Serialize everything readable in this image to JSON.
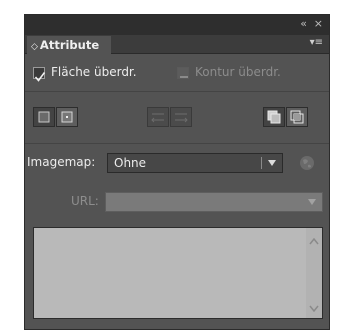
{
  "window": {
    "collapse_glyph": "«",
    "close_glyph": "×"
  },
  "tab": {
    "chevron": "◇",
    "label": "Attribute",
    "menu_glyph": "▾≡"
  },
  "overprint": {
    "fill_label": "Fläche überdr.",
    "fill_checked": true,
    "stroke_label": "Kontur überdr.",
    "stroke_checked": false
  },
  "icons": {
    "group1": [
      "hide-center-icon",
      "show-center-icon"
    ],
    "group2": [
      "reverse-path-left-icon",
      "reverse-path-right-icon"
    ],
    "group3": [
      "nonzero-winding-icon",
      "even-odd-icon"
    ]
  },
  "imagemap": {
    "label": "Imagemap:",
    "value": "Ohne",
    "browser_icon": "browser-globe-icon"
  },
  "url": {
    "label": "URL:",
    "value": ""
  },
  "colors": {
    "panel_bg": "#535353",
    "title_bg": "#2e2e2e",
    "list_bg": "#b9b9b9"
  }
}
